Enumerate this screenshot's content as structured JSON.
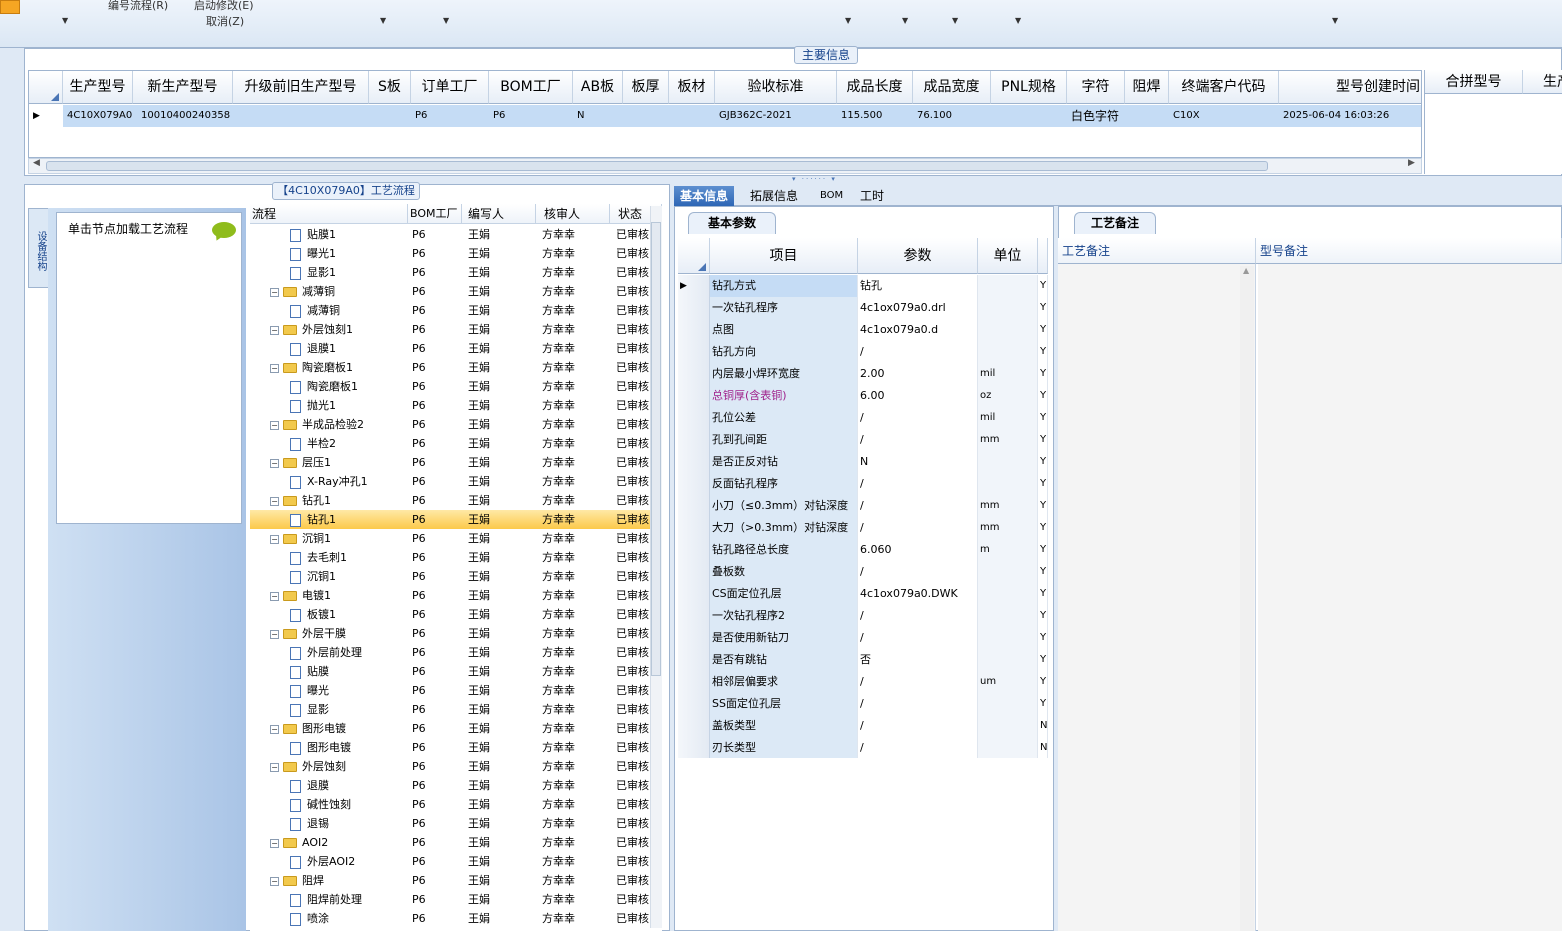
{
  "ribbon": {
    "menu1": "编号流程(R)",
    "menu2": "启动修改(E)",
    "menu3": "取消(Z)"
  },
  "main_info": {
    "legend": "主要信息",
    "columns": [
      "生产型号",
      "新生产型号",
      "升级前旧生产型号",
      "S板",
      "订单工厂",
      "BOM工厂",
      "AB板",
      "板厚",
      "板材",
      "验收标准",
      "成品长度",
      "成品宽度",
      "PNL规格",
      "字符",
      "阻焊",
      "终端客户代码",
      "型号创建时间"
    ],
    "row": [
      "4C10X079A0",
      "10010400240358",
      "",
      "",
      "P6",
      "P6",
      "N",
      "",
      "",
      "GJB362C-2021",
      "115.500",
      "76.100",
      "",
      "白色字符",
      "",
      "C10X",
      "2025-06-04 16:03:26"
    ],
    "right_columns": [
      "合拼型号",
      "生产"
    ]
  },
  "flow": {
    "tab_title": "【4C10X079A0】工艺流程",
    "vtab": "设备结构",
    "nav_text": "单击节点加载工艺流程",
    "columns": [
      "流程",
      "BOM工厂",
      "编写人",
      "核审人",
      "状态"
    ],
    "rows": [
      {
        "level": 2,
        "type": "doc",
        "name": "贴膜1",
        "bom": "P6",
        "writer": "王娟",
        "checker": "方幸幸",
        "status": "已审核"
      },
      {
        "level": 2,
        "type": "doc",
        "name": "曝光1",
        "bom": "P6",
        "writer": "王娟",
        "checker": "方幸幸",
        "status": "已审核"
      },
      {
        "level": 2,
        "type": "doc",
        "name": "显影1",
        "bom": "P6",
        "writer": "王娟",
        "checker": "方幸幸",
        "status": "已审核"
      },
      {
        "level": 1,
        "type": "folder",
        "name": "减薄铜",
        "bom": "P6",
        "writer": "王娟",
        "checker": "方幸幸",
        "status": "已审核"
      },
      {
        "level": 2,
        "type": "doc",
        "name": "减薄铜",
        "bom": "P6",
        "writer": "王娟",
        "checker": "方幸幸",
        "status": "已审核"
      },
      {
        "level": 1,
        "type": "folder",
        "name": "外层蚀刻1",
        "bom": "P6",
        "writer": "王娟",
        "checker": "方幸幸",
        "status": "已审核"
      },
      {
        "level": 2,
        "type": "doc",
        "name": "退膜1",
        "bom": "P6",
        "writer": "王娟",
        "checker": "方幸幸",
        "status": "已审核"
      },
      {
        "level": 1,
        "type": "folder",
        "name": "陶瓷磨板1",
        "bom": "P6",
        "writer": "王娟",
        "checker": "方幸幸",
        "status": "已审核"
      },
      {
        "level": 2,
        "type": "doc",
        "name": "陶瓷磨板1",
        "bom": "P6",
        "writer": "王娟",
        "checker": "方幸幸",
        "status": "已审核"
      },
      {
        "level": 2,
        "type": "doc",
        "name": "抛光1",
        "bom": "P6",
        "writer": "王娟",
        "checker": "方幸幸",
        "status": "已审核"
      },
      {
        "level": 1,
        "type": "folder",
        "name": "半成品检验2",
        "bom": "P6",
        "writer": "王娟",
        "checker": "方幸幸",
        "status": "已审核"
      },
      {
        "level": 2,
        "type": "doc",
        "name": "半检2",
        "bom": "P6",
        "writer": "王娟",
        "checker": "方幸幸",
        "status": "已审核"
      },
      {
        "level": 1,
        "type": "folder",
        "name": "层压1",
        "bom": "P6",
        "writer": "王娟",
        "checker": "方幸幸",
        "status": "已审核"
      },
      {
        "level": 2,
        "type": "doc",
        "name": "X-Ray冲孔1",
        "bom": "P6",
        "writer": "王娟",
        "checker": "方幸幸",
        "status": "已审核"
      },
      {
        "level": 1,
        "type": "folder",
        "name": "钻孔1",
        "bom": "P6",
        "writer": "王娟",
        "checker": "方幸幸",
        "status": "已审核"
      },
      {
        "level": 2,
        "type": "doc",
        "name": "钻孔1",
        "bom": "P6",
        "writer": "王娟",
        "checker": "方幸幸",
        "status": "已审核",
        "selected": true
      },
      {
        "level": 1,
        "type": "folder",
        "name": "沉铜1",
        "bom": "P6",
        "writer": "王娟",
        "checker": "方幸幸",
        "status": "已审核"
      },
      {
        "level": 2,
        "type": "doc",
        "name": "去毛刺1",
        "bom": "P6",
        "writer": "王娟",
        "checker": "方幸幸",
        "status": "已审核"
      },
      {
        "level": 2,
        "type": "doc",
        "name": "沉铜1",
        "bom": "P6",
        "writer": "王娟",
        "checker": "方幸幸",
        "status": "已审核"
      },
      {
        "level": 1,
        "type": "folder",
        "name": "电镀1",
        "bom": "P6",
        "writer": "王娟",
        "checker": "方幸幸",
        "status": "已审核"
      },
      {
        "level": 2,
        "type": "doc",
        "name": "板镀1",
        "bom": "P6",
        "writer": "王娟",
        "checker": "方幸幸",
        "status": "已审核"
      },
      {
        "level": 1,
        "type": "folder",
        "name": "外层干膜",
        "bom": "P6",
        "writer": "王娟",
        "checker": "方幸幸",
        "status": "已审核"
      },
      {
        "level": 2,
        "type": "doc",
        "name": "外层前处理",
        "bom": "P6",
        "writer": "王娟",
        "checker": "方幸幸",
        "status": "已审核"
      },
      {
        "level": 2,
        "type": "doc",
        "name": "贴膜",
        "bom": "P6",
        "writer": "王娟",
        "checker": "方幸幸",
        "status": "已审核"
      },
      {
        "level": 2,
        "type": "doc",
        "name": "曝光",
        "bom": "P6",
        "writer": "王娟",
        "checker": "方幸幸",
        "status": "已审核"
      },
      {
        "level": 2,
        "type": "doc",
        "name": "显影",
        "bom": "P6",
        "writer": "王娟",
        "checker": "方幸幸",
        "status": "已审核"
      },
      {
        "level": 1,
        "type": "folder",
        "name": "图形电镀",
        "bom": "P6",
        "writer": "王娟",
        "checker": "方幸幸",
        "status": "已审核"
      },
      {
        "level": 2,
        "type": "doc",
        "name": "图形电镀",
        "bom": "P6",
        "writer": "王娟",
        "checker": "方幸幸",
        "status": "已审核"
      },
      {
        "level": 1,
        "type": "folder",
        "name": "外层蚀刻",
        "bom": "P6",
        "writer": "王娟",
        "checker": "方幸幸",
        "status": "已审核"
      },
      {
        "level": 2,
        "type": "doc",
        "name": "退膜",
        "bom": "P6",
        "writer": "王娟",
        "checker": "方幸幸",
        "status": "已审核"
      },
      {
        "level": 2,
        "type": "doc",
        "name": "碱性蚀刻",
        "bom": "P6",
        "writer": "王娟",
        "checker": "方幸幸",
        "status": "已审核"
      },
      {
        "level": 2,
        "type": "doc",
        "name": "退锡",
        "bom": "P6",
        "writer": "王娟",
        "checker": "方幸幸",
        "status": "已审核"
      },
      {
        "level": 1,
        "type": "folder",
        "name": "AOI2",
        "bom": "P6",
        "writer": "王娟",
        "checker": "方幸幸",
        "status": "已审核"
      },
      {
        "level": 2,
        "type": "doc",
        "name": "外层AOI2",
        "bom": "P6",
        "writer": "王娟",
        "checker": "方幸幸",
        "status": "已审核"
      },
      {
        "level": 1,
        "type": "folder",
        "name": "阻焊",
        "bom": "P6",
        "writer": "王娟",
        "checker": "方幸幸",
        "status": "已审核"
      },
      {
        "level": 2,
        "type": "doc",
        "name": "阻焊前处理",
        "bom": "P6",
        "writer": "王娟",
        "checker": "方幸幸",
        "status": "已审核"
      },
      {
        "level": 2,
        "type": "doc",
        "name": "喷涂",
        "bom": "P6",
        "writer": "王娟",
        "checker": "方幸幸",
        "status": "已审核"
      }
    ]
  },
  "tabs": [
    "基本信息",
    "拓展信息",
    "BOM",
    "工时"
  ],
  "basic_params": {
    "tab": "基本参数",
    "columns": [
      "项目",
      "参数",
      "单位"
    ],
    "rows": [
      {
        "item": "钻孔方式",
        "value": "钻孔",
        "unit": "",
        "flag": "Y",
        "highlight": true
      },
      {
        "item": "一次钻孔程序",
        "value": "4c1ox079a0.drl",
        "unit": "",
        "flag": "Y"
      },
      {
        "item": "点图",
        "value": "4c1ox079a0.d",
        "unit": "",
        "flag": "Y"
      },
      {
        "item": "钻孔方向",
        "value": "/",
        "unit": "",
        "flag": "Y"
      },
      {
        "item": "内层最小焊环宽度",
        "value": "2.00",
        "unit": "mil",
        "flag": "Y"
      },
      {
        "item": "总铜厚(含表铜)",
        "value": "6.00",
        "unit": "oz",
        "flag": "Y",
        "purple": true
      },
      {
        "item": "孔位公差",
        "value": "/",
        "unit": "mil",
        "flag": "Y"
      },
      {
        "item": "孔到孔间距",
        "value": "/",
        "unit": "mm",
        "flag": "Y"
      },
      {
        "item": "是否正反对钻",
        "value": "N",
        "unit": "",
        "flag": "Y"
      },
      {
        "item": "反面钻孔程序",
        "value": "/",
        "unit": "",
        "flag": "Y"
      },
      {
        "item": "小刀（≤0.3mm）对钻深度",
        "value": "/",
        "unit": "mm",
        "flag": "Y"
      },
      {
        "item": "大刀（>0.3mm）对钻深度",
        "value": "/",
        "unit": "mm",
        "flag": "Y"
      },
      {
        "item": "钻孔路径总长度",
        "value": "6.060",
        "unit": "m",
        "flag": "Y"
      },
      {
        "item": "叠板数",
        "value": "/",
        "unit": "",
        "flag": "Y"
      },
      {
        "item": "CS面定位孔层",
        "value": "4c1ox079a0.DWK",
        "unit": "",
        "flag": "Y"
      },
      {
        "item": "一次钻孔程序2",
        "value": "/",
        "unit": "",
        "flag": "Y"
      },
      {
        "item": "是否使用新钻刀",
        "value": "/",
        "unit": "",
        "flag": "Y"
      },
      {
        "item": "是否有跳钻",
        "value": "否",
        "unit": "",
        "flag": "Y"
      },
      {
        "item": "相邻层偏要求",
        "value": "/",
        "unit": "um",
        "flag": "Y"
      },
      {
        "item": "SS面定位孔层",
        "value": "/",
        "unit": "",
        "flag": "Y"
      },
      {
        "item": "盖板类型",
        "value": "/",
        "unit": "",
        "flag": "N"
      },
      {
        "item": "刃长类型",
        "value": "/",
        "unit": "",
        "flag": "N"
      }
    ]
  },
  "notes": {
    "tab": "工艺备注",
    "col1": "工艺备注",
    "col2": "型号备注"
  }
}
